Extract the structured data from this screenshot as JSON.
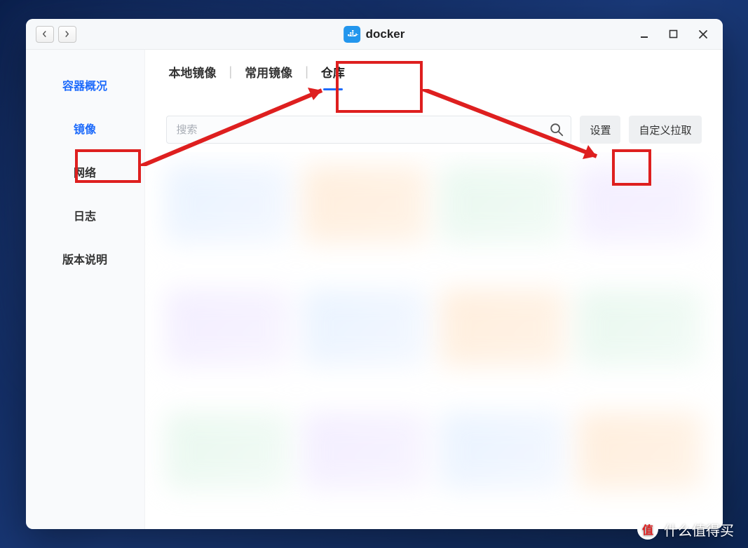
{
  "window": {
    "title": "docker"
  },
  "sidebar": {
    "items": [
      {
        "label": "容器概况",
        "active": false
      },
      {
        "label": "镜像",
        "active": true
      },
      {
        "label": "网络",
        "active": false
      },
      {
        "label": "日志",
        "active": false
      },
      {
        "label": "版本说明",
        "active": false
      }
    ]
  },
  "tabs": [
    {
      "label": "本地镜像",
      "active": false
    },
    {
      "label": "常用镜像",
      "active": false
    },
    {
      "label": "仓库",
      "active": true
    }
  ],
  "toolbar": {
    "search_placeholder": "搜索",
    "settings_label": "设置",
    "custom_pull_label": "自定义拉取"
  },
  "watermark": {
    "badge": "值",
    "text": "什么值得买"
  },
  "annotations": {
    "highlight_boxes": [
      "sidebar-mirror",
      "tab-repository",
      "settings-button"
    ],
    "arrows": [
      "sidebar-to-tab",
      "tab-to-settings"
    ]
  }
}
